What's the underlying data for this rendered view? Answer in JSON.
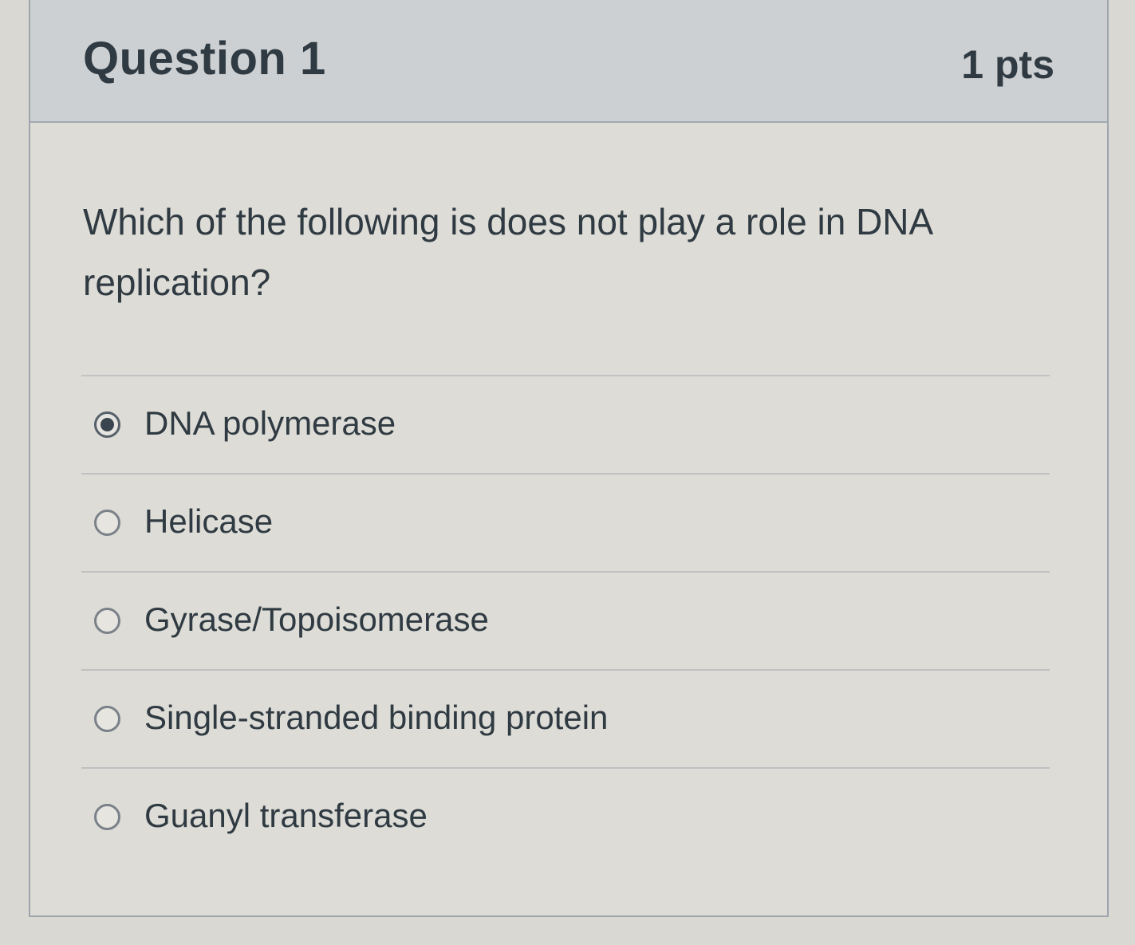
{
  "question": {
    "title": "Question 1",
    "points": "1 pts",
    "text": "Which of the following is does not play a role in DNA replication?",
    "selected_index": 0,
    "answers": [
      {
        "label": "DNA polymerase",
        "checked": true
      },
      {
        "label": "Helicase",
        "checked": false
      },
      {
        "label": "Gyrase/Topoisomerase",
        "checked": false
      },
      {
        "label": "Single-stranded binding protein",
        "checked": false
      },
      {
        "label": "Guanyl transferase",
        "checked": false
      }
    ]
  },
  "icons": {
    "radio_checked": "radio-checked-icon",
    "radio_unchecked": "radio-unchecked-icon"
  },
  "colors": {
    "header_bg": "#cdd0d2",
    "card_bg": "#dddcd6",
    "text": "#2f3a42",
    "border": "#9ea5ad"
  }
}
